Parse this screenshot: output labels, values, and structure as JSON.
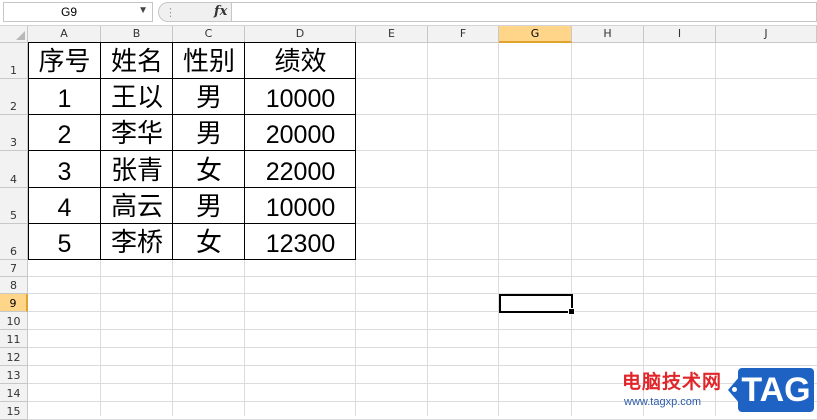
{
  "formula_bar": {
    "name_box": "G9",
    "fx_label": "fx",
    "formula": ""
  },
  "columns": [
    "A",
    "B",
    "C",
    "D",
    "E",
    "F",
    "G",
    "H",
    "I",
    "J"
  ],
  "selected_column": "G",
  "rows": [
    "1",
    "2",
    "3",
    "4",
    "5",
    "6",
    "7",
    "8",
    "9",
    "10",
    "11",
    "12",
    "13",
    "14",
    "15"
  ],
  "selected_row": "9",
  "table": {
    "headers": [
      "序号",
      "姓名",
      "性别",
      "绩效"
    ],
    "data": [
      [
        "1",
        "王以",
        "男",
        "10000"
      ],
      [
        "2",
        "李华",
        "男",
        "20000"
      ],
      [
        "3",
        "张青",
        "女",
        "22000"
      ],
      [
        "4",
        "高云",
        "男",
        "10000"
      ],
      [
        "5",
        "李桥",
        "女",
        "12300"
      ]
    ]
  },
  "watermark": {
    "site_name": "电脑技术网",
    "url": "www.tagxp.com",
    "tag": "TAG"
  }
}
